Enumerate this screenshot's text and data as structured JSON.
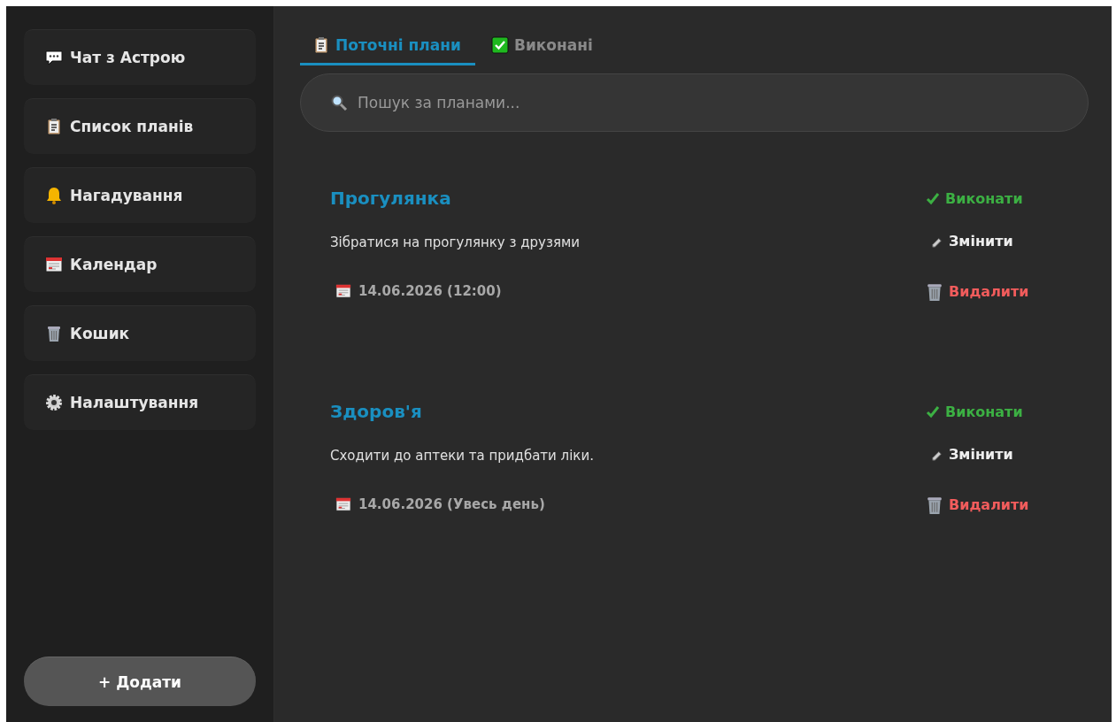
{
  "sidebar": {
    "items": [
      {
        "label": "Чат з Астрою"
      },
      {
        "label": "Список планів"
      },
      {
        "label": "Нагадування"
      },
      {
        "label": "Календар"
      },
      {
        "label": "Кошик"
      },
      {
        "label": "Налаштування"
      }
    ],
    "add_button": "+ Додати"
  },
  "tabs": [
    {
      "label": "Поточні плани",
      "selected": true
    },
    {
      "label": "Виконані",
      "selected": false
    }
  ],
  "search": {
    "placeholder": "Пошук за планами..."
  },
  "plans": [
    {
      "title": "Прогулянка",
      "description": "Зібратися на прогулянку з друзями",
      "date": "14.06.2026 (12:00)",
      "actions": [
        "Виконати",
        "Змінити",
        "Видалити"
      ]
    },
    {
      "title": "Здоров'я",
      "description": "Сходити до аптеки та придбати ліки.",
      "date": "14.06.2026 (Увесь день)",
      "actions": [
        "Виконати",
        "Змінити",
        "Видалити"
      ]
    }
  ]
}
